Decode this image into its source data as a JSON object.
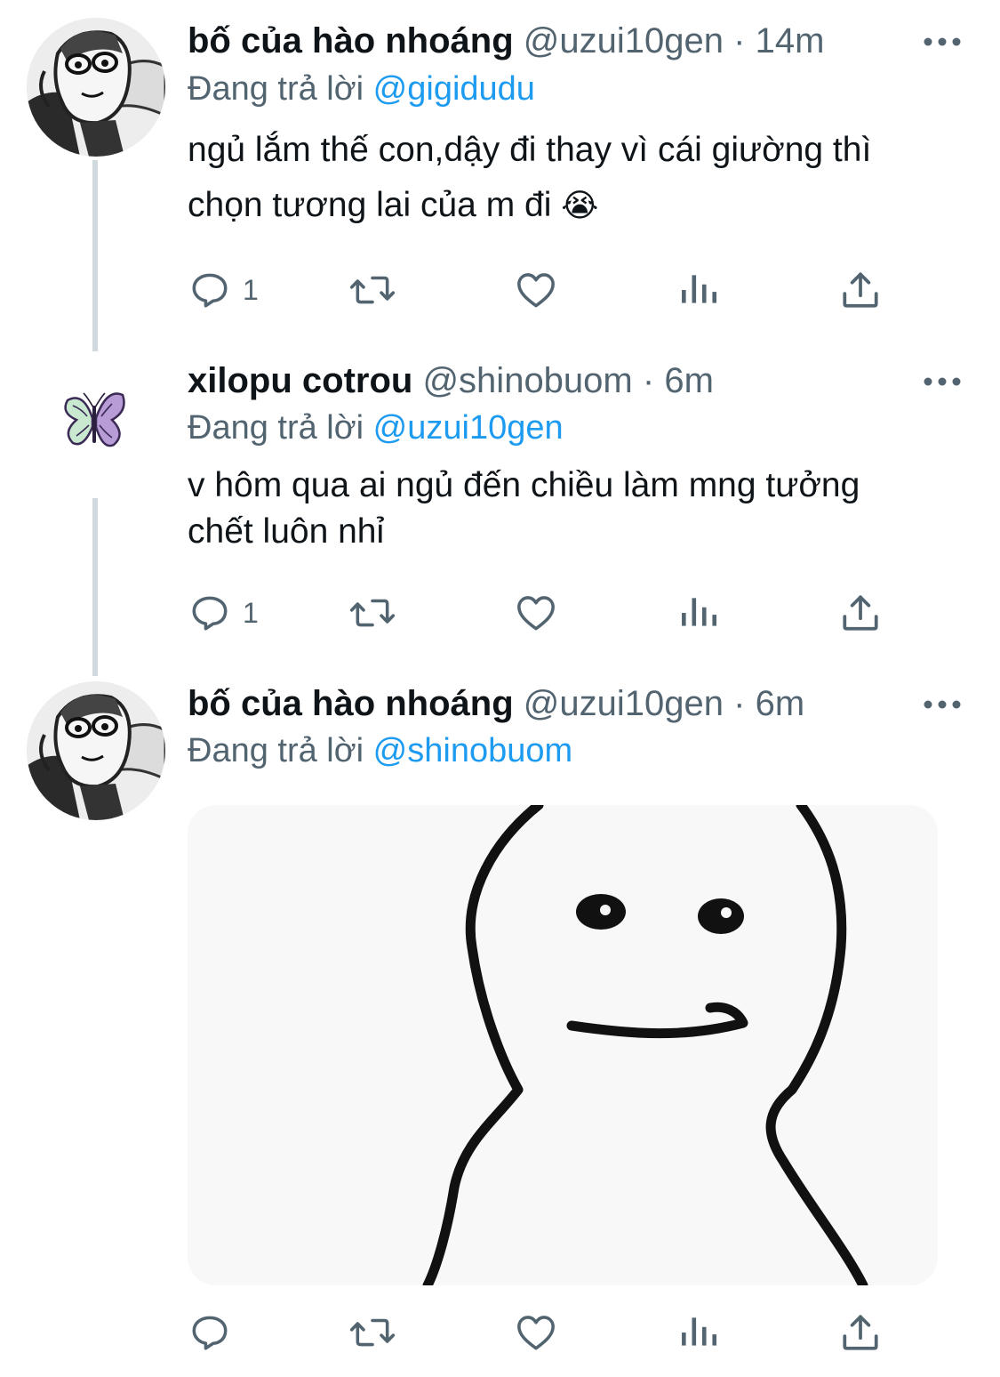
{
  "tweets": [
    {
      "name": "bố của hào nhoáng",
      "handle": "@uzui10gen",
      "separator": "·",
      "time": "14m",
      "reply_prefix": "Đang trả lời",
      "reply_to": "@gigidudu",
      "text_line1": "ngủ lắm thế con,dậy đi thay vì cái giường thì",
      "text_line2": "chọn tương lai của m đi",
      "emoji": "😭",
      "reply_count": "1",
      "avatar_icon": "manga-character-avatar"
    },
    {
      "name": "xilopu cotrou",
      "handle": "@shinobuom",
      "separator": "·",
      "time": "6m",
      "reply_prefix": "Đang trả lời",
      "reply_to": "@uzui10gen",
      "text_line1": "v hôm qua ai ngủ đến chiều làm mng tưởng",
      "text_line2": "chết luôn nhỉ",
      "reply_count": "1",
      "avatar_icon": "butterfly-avatar"
    },
    {
      "name": "bố của hào nhoáng",
      "handle": "@uzui10gen",
      "separator": "·",
      "time": "6m",
      "reply_prefix": "Đang trả lời",
      "reply_to": "@shinobuom",
      "media_icon": "meme-blob-face-image",
      "avatar_icon": "manga-character-avatar"
    }
  ],
  "icons": {
    "reply": "reply-icon",
    "retweet": "retweet-icon",
    "like": "like-icon",
    "views": "views-icon",
    "share": "share-icon",
    "more": "more-icon"
  },
  "colors": {
    "text": "#0f1419",
    "secondary": "#536471",
    "accent": "#1d9bf0",
    "thread_line": "#cfd9de"
  }
}
